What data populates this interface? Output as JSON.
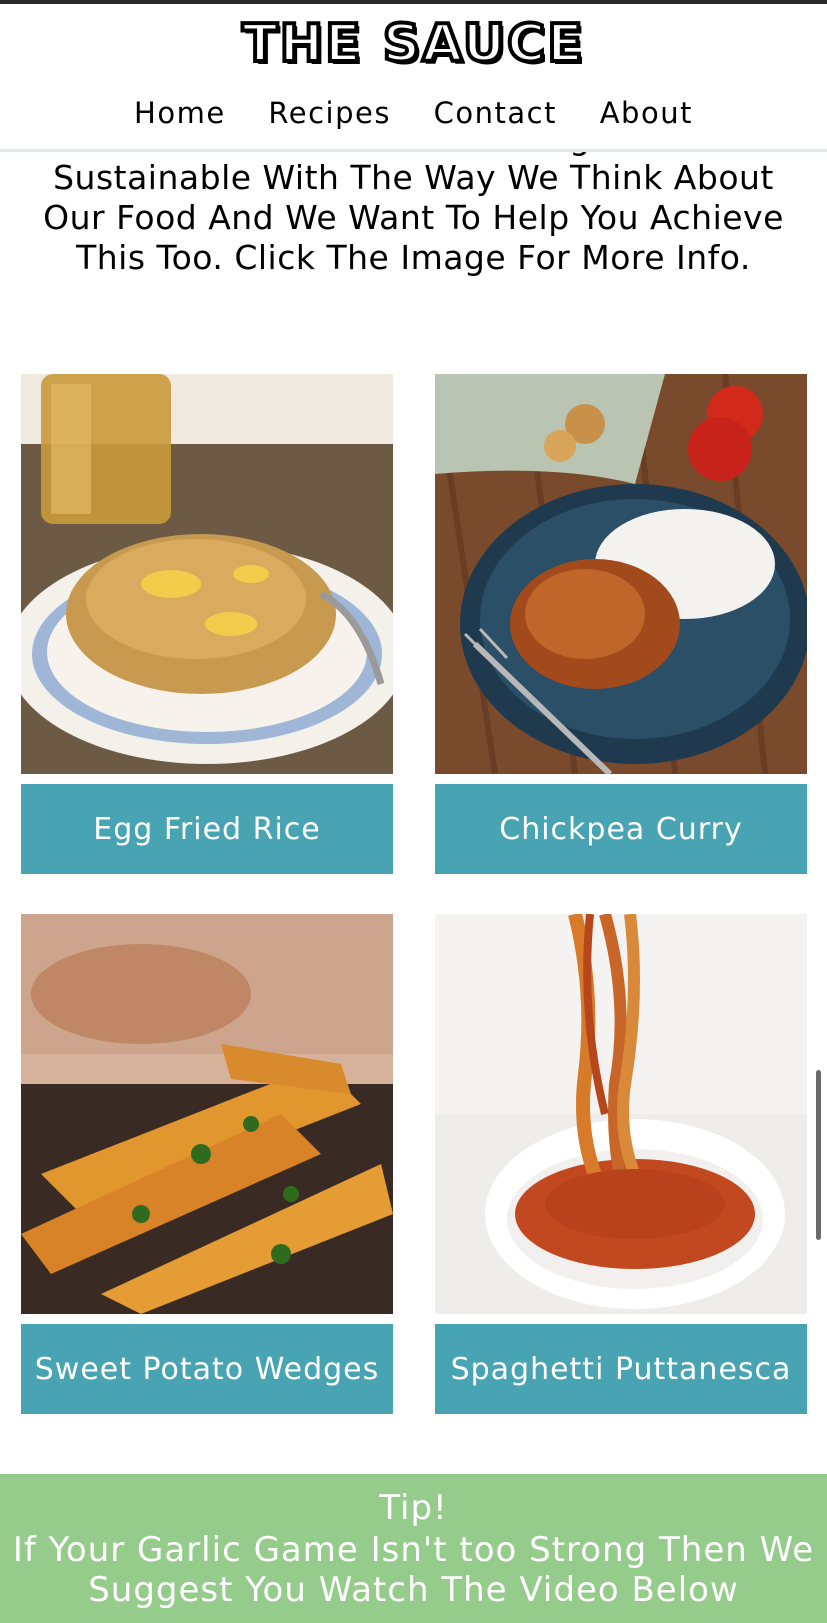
{
  "site": {
    "logo": "THE SAUCE"
  },
  "nav": {
    "items": [
      "Home",
      "Recipes",
      "Contact",
      "About"
    ]
  },
  "intro": {
    "partial_line": "We're Committed To Being More",
    "text": "Sustainable With The Way We Think About Our Food And We Want To Help You Achieve This Too. Click The Image For More Info."
  },
  "recipes": [
    {
      "label": "Egg Fried Rice"
    },
    {
      "label": "Chickpea Curry"
    },
    {
      "label": "Sweet Potato Wedges"
    },
    {
      "label": "Spaghetti Puttanesca"
    }
  ],
  "tip": {
    "title": "Tip!",
    "text": "If Your Garlic Game Isn't too Strong Then We Suggest You Watch The Video Below"
  },
  "colors": {
    "button": "#48a4b3",
    "tip_bg": "#96cc8b"
  }
}
